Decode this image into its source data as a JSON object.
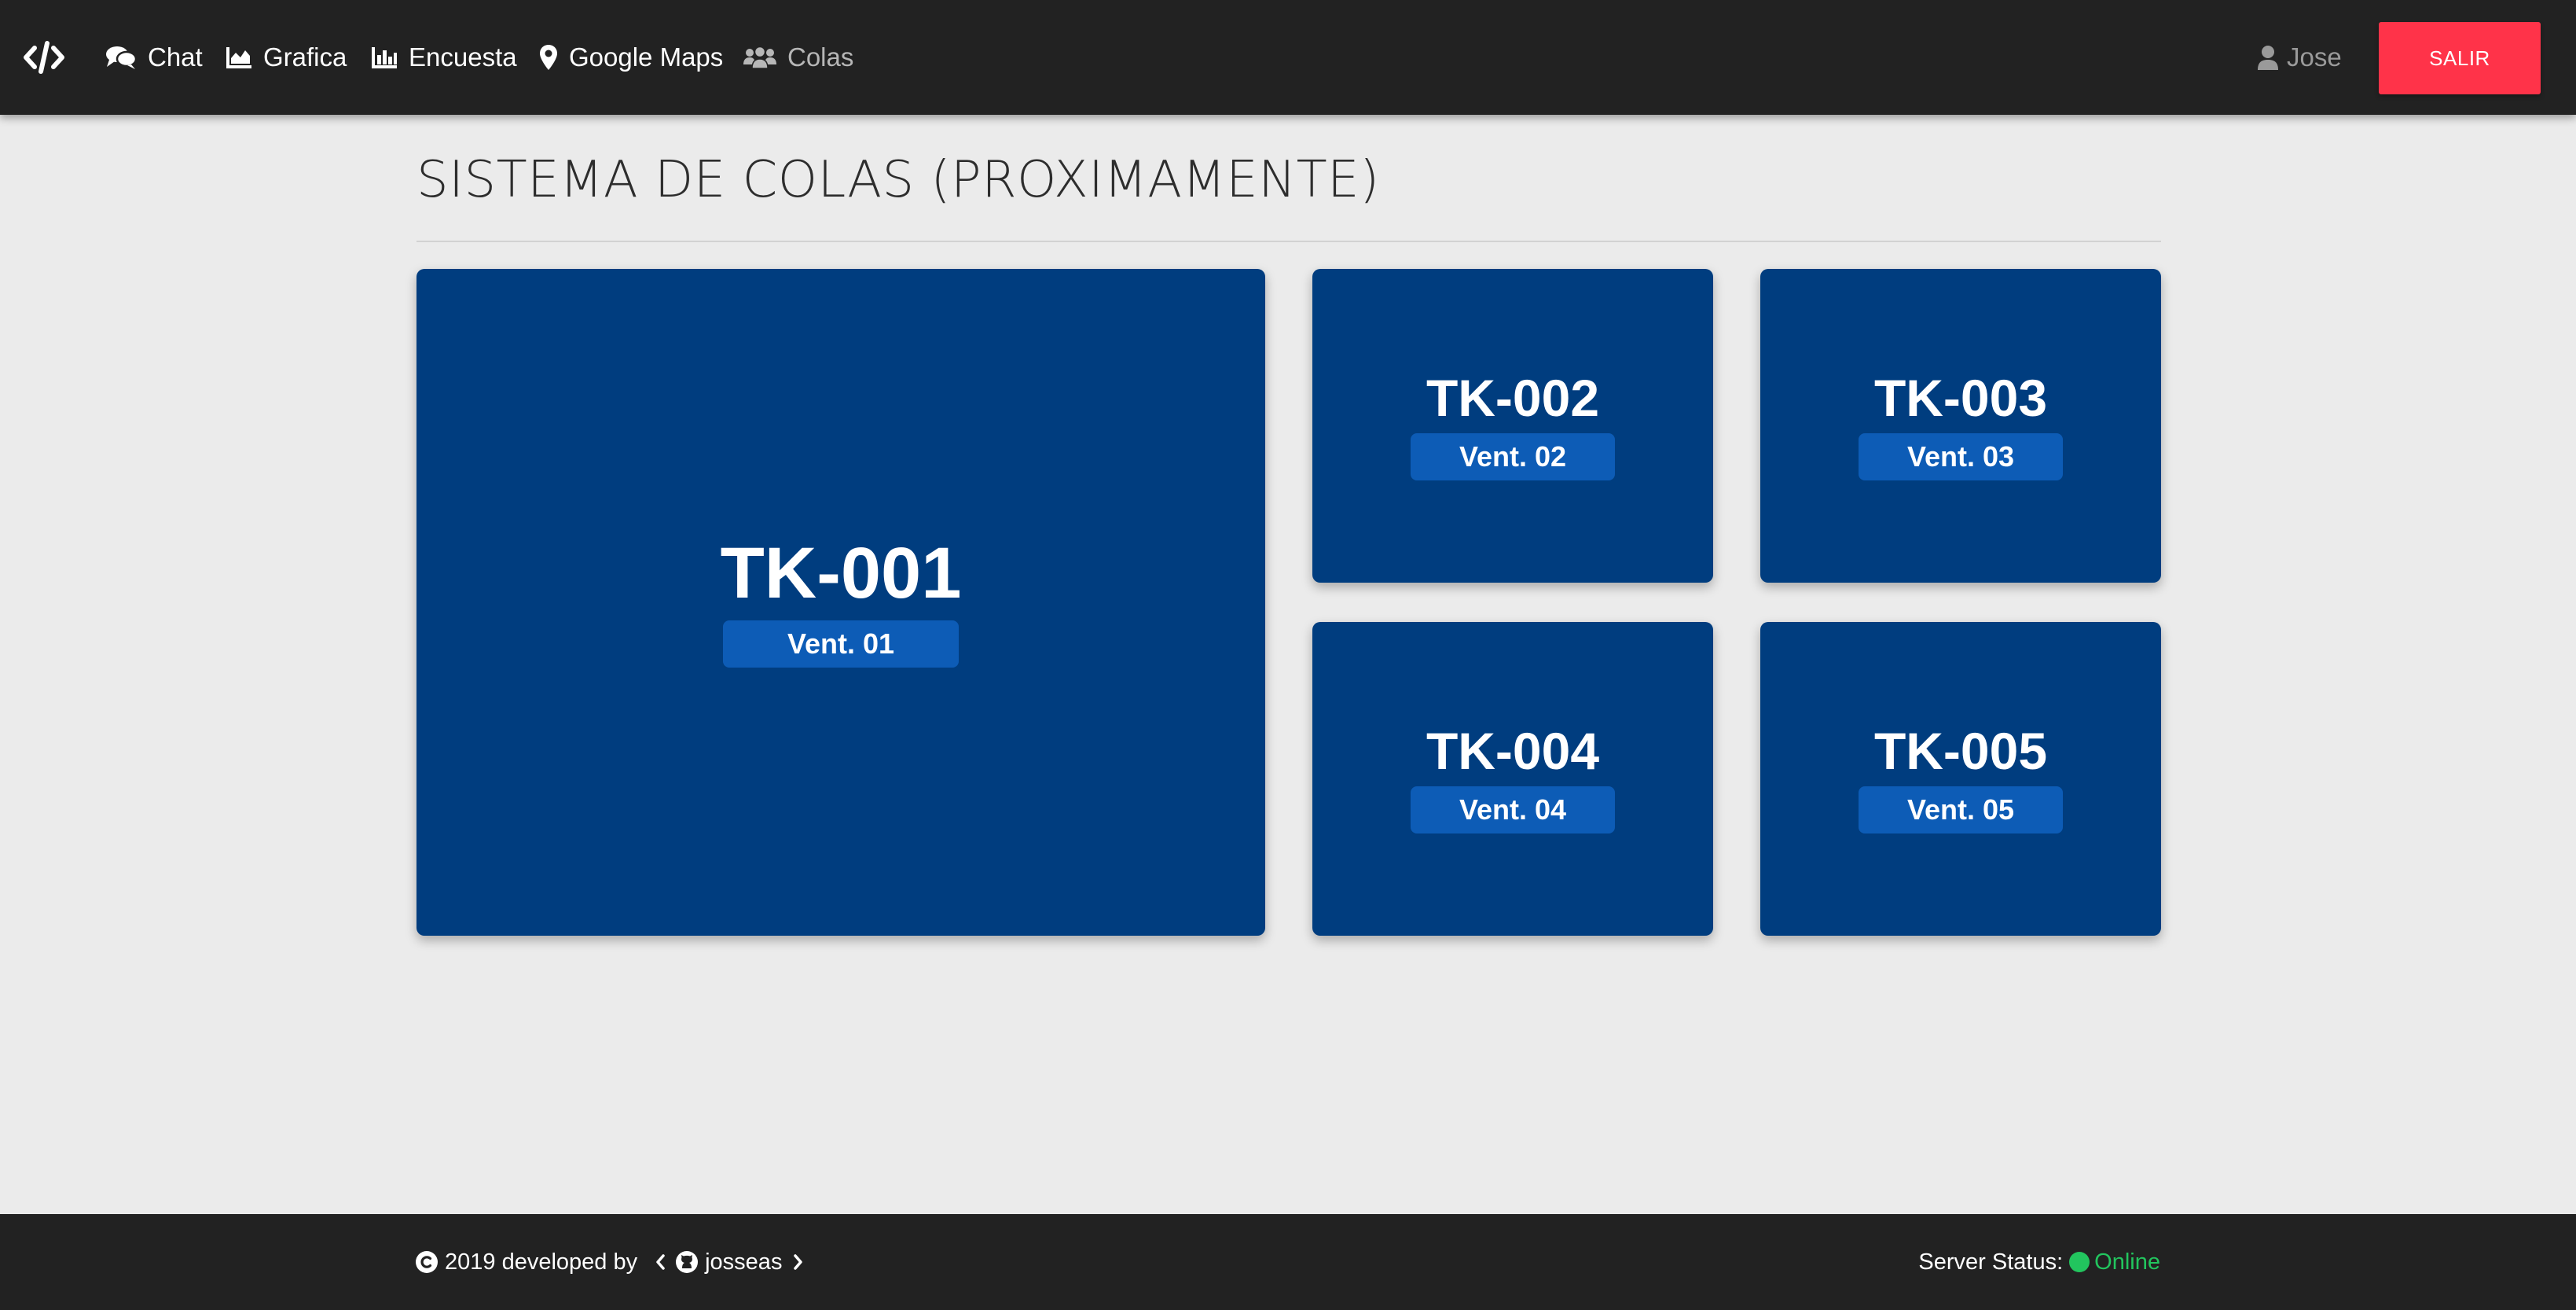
{
  "navbar": {
    "brand_icon": "code-icon",
    "items": [
      {
        "label": "Chat",
        "icon": "comments-icon"
      },
      {
        "label": "Grafica",
        "icon": "area-chart-icon"
      },
      {
        "label": "Encuesta",
        "icon": "bar-chart-icon"
      },
      {
        "label": "Google Maps",
        "icon": "map-marker-icon"
      },
      {
        "label": "Colas",
        "icon": "users-icon",
        "active": true
      }
    ],
    "user_name": "Jose",
    "logout_label": "SALIR"
  },
  "main": {
    "title": "SISTEMA DE COLAS (PROXIMAMENTE)",
    "tickets": [
      {
        "code": "TK-001",
        "window": "Vent. 01"
      },
      {
        "code": "TK-002",
        "window": "Vent. 02"
      },
      {
        "code": "TK-003",
        "window": "Vent. 03"
      },
      {
        "code": "TK-004",
        "window": "Vent. 04"
      },
      {
        "code": "TK-005",
        "window": "Vent. 05"
      }
    ]
  },
  "footer": {
    "copyright": "2019 developed by",
    "author": "josseas",
    "status_label": "Server Status:",
    "status_value": "Online"
  },
  "colors": {
    "navbar_bg": "#222222",
    "page_bg": "#ebebeb",
    "ticket_bg": "#003d7f",
    "ticket_badge": "#0d5cb6",
    "logout_bg": "#ff3349",
    "online": "#22c55e"
  }
}
